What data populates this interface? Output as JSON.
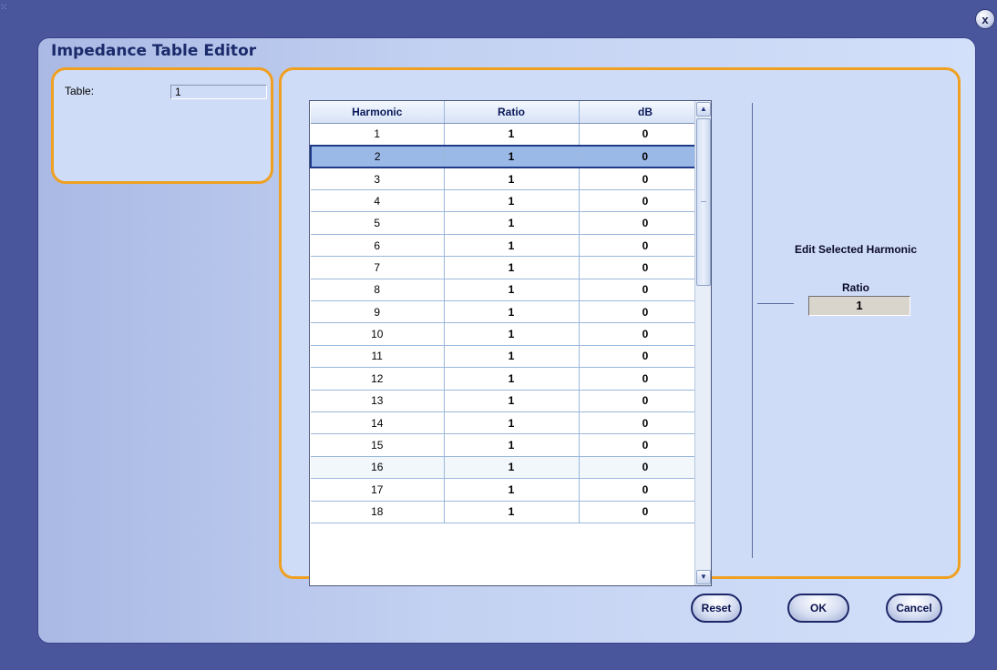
{
  "window": {
    "title": "Impedance Table Editor",
    "close_label": "x"
  },
  "left_panel": {
    "table_label": "Table:",
    "table_value": "1"
  },
  "grid": {
    "columns": [
      "Harmonic",
      "Ratio",
      "dB"
    ],
    "selected_index": 1,
    "rows": [
      {
        "harmonic": "1",
        "ratio": "1",
        "db": "0"
      },
      {
        "harmonic": "2",
        "ratio": "1",
        "db": "0"
      },
      {
        "harmonic": "3",
        "ratio": "1",
        "db": "0"
      },
      {
        "harmonic": "4",
        "ratio": "1",
        "db": "0"
      },
      {
        "harmonic": "5",
        "ratio": "1",
        "db": "0"
      },
      {
        "harmonic": "6",
        "ratio": "1",
        "db": "0"
      },
      {
        "harmonic": "7",
        "ratio": "1",
        "db": "0"
      },
      {
        "harmonic": "8",
        "ratio": "1",
        "db": "0"
      },
      {
        "harmonic": "9",
        "ratio": "1",
        "db": "0"
      },
      {
        "harmonic": "10",
        "ratio": "1",
        "db": "0"
      },
      {
        "harmonic": "11",
        "ratio": "1",
        "db": "0"
      },
      {
        "harmonic": "12",
        "ratio": "1",
        "db": "0"
      },
      {
        "harmonic": "13",
        "ratio": "1",
        "db": "0"
      },
      {
        "harmonic": "14",
        "ratio": "1",
        "db": "0"
      },
      {
        "harmonic": "15",
        "ratio": "1",
        "db": "0"
      },
      {
        "harmonic": "16",
        "ratio": "1",
        "db": "0"
      },
      {
        "harmonic": "17",
        "ratio": "1",
        "db": "0"
      },
      {
        "harmonic": "18",
        "ratio": "1",
        "db": "0"
      }
    ]
  },
  "edit_panel": {
    "heading": "Edit Selected Harmonic",
    "ratio_label": "Ratio",
    "ratio_value": "1"
  },
  "buttons": {
    "reset": "Reset",
    "ok": "OK",
    "cancel": "Cancel"
  },
  "colors": {
    "background": "#4a569c",
    "panel_border": "#f0a020",
    "selection": "#9bb9e6"
  }
}
